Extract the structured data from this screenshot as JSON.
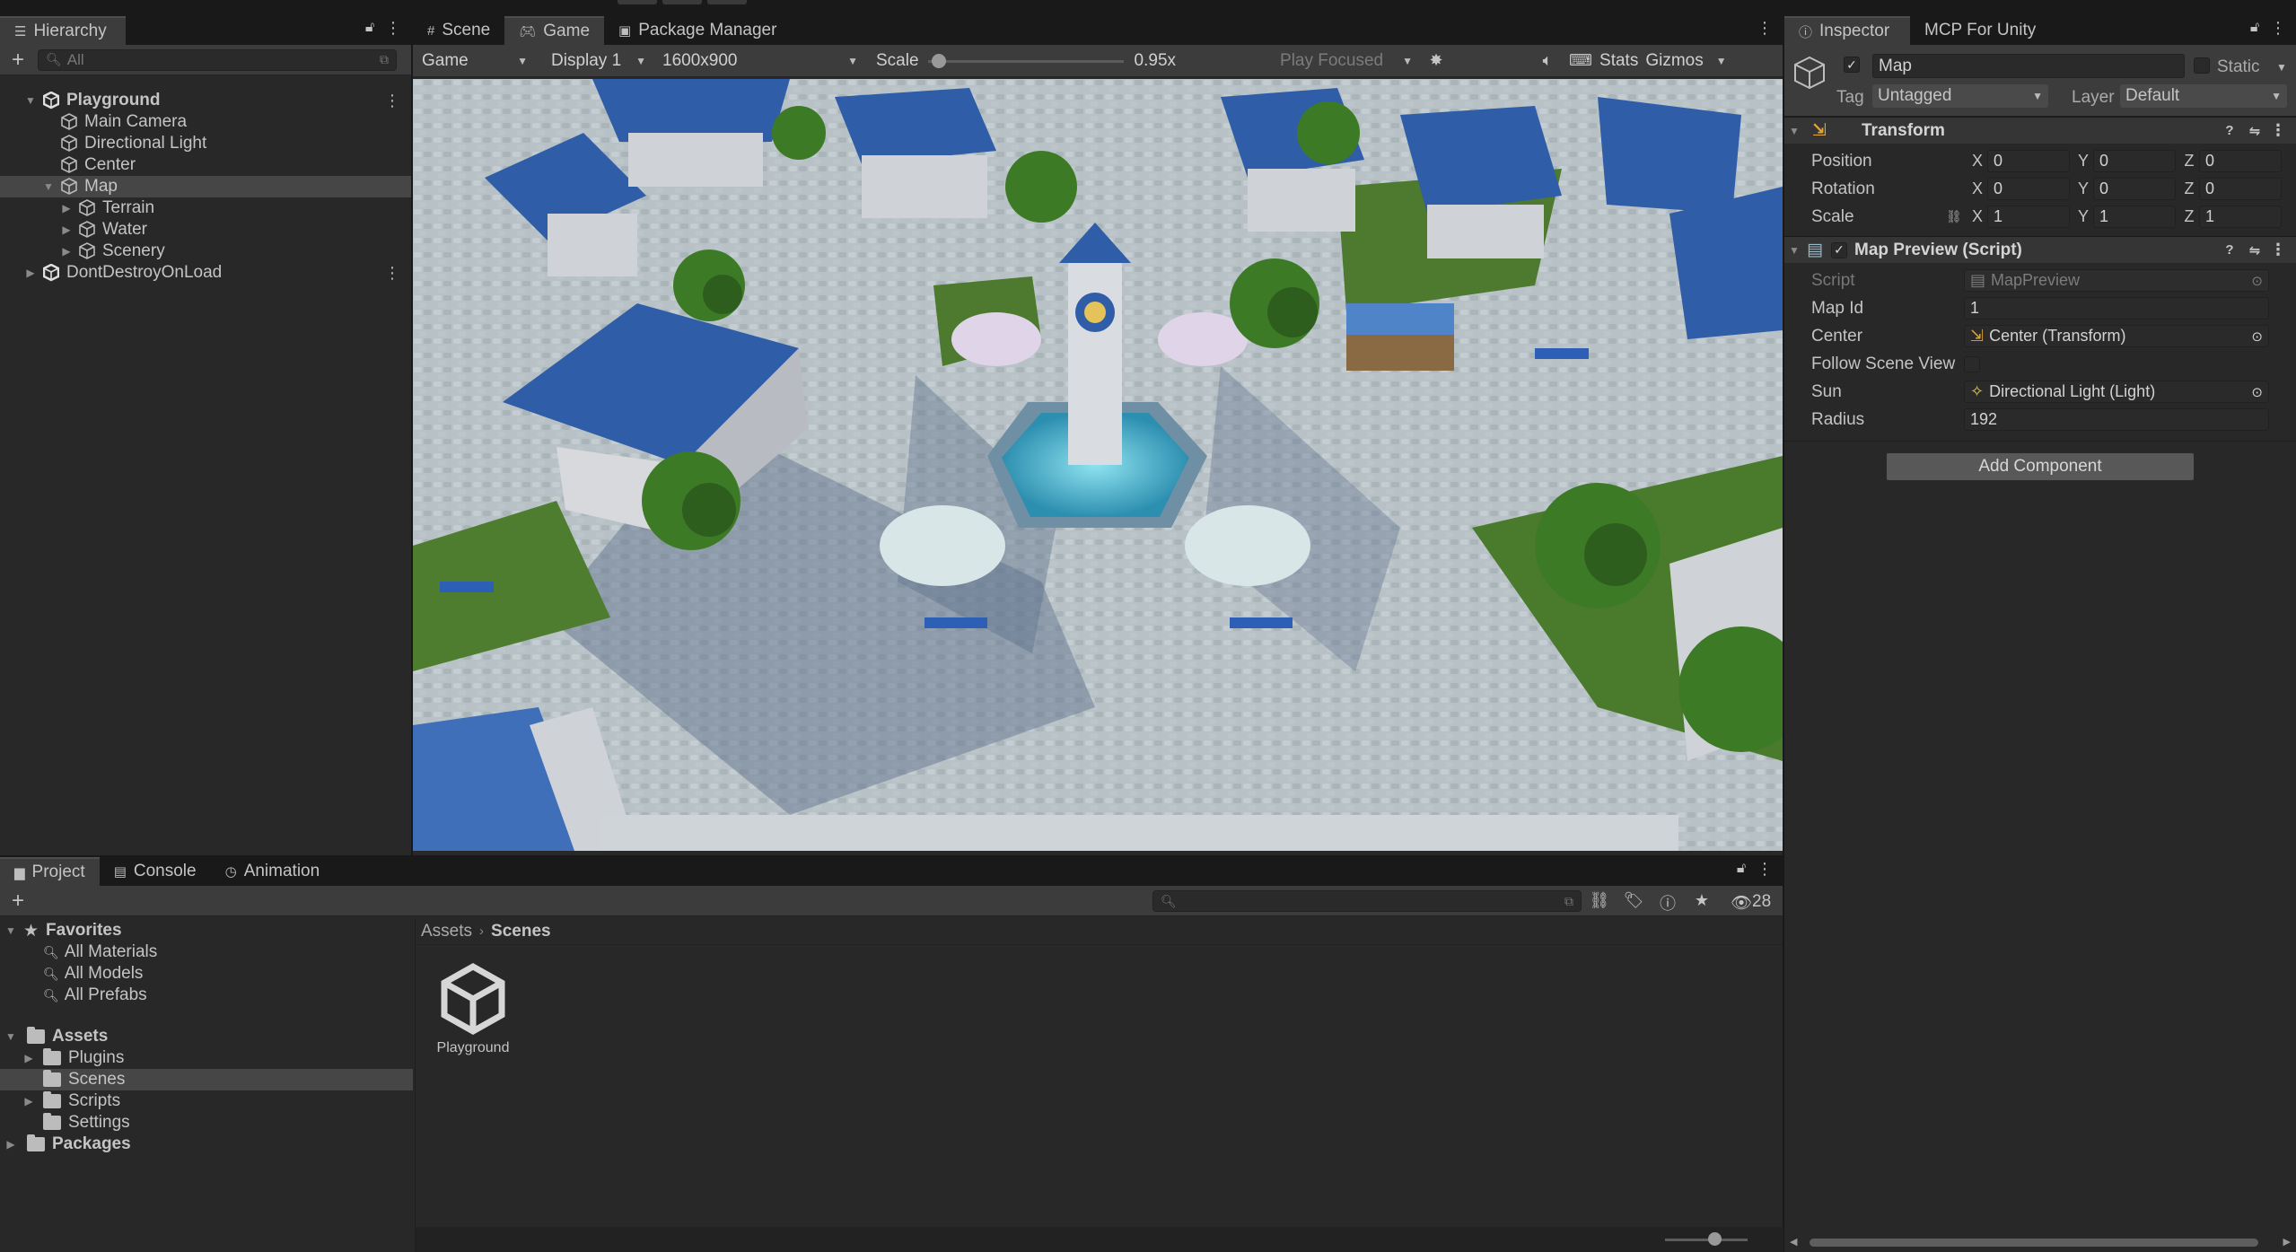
{
  "hierarchy": {
    "tab_label": "Hierarchy",
    "add_label": "+",
    "search_placeholder": "All",
    "items": [
      {
        "label": "Playground",
        "depth": 0,
        "expanded": true,
        "scene": true
      },
      {
        "label": "Main Camera",
        "depth": 1
      },
      {
        "label": "Directional Light",
        "depth": 1
      },
      {
        "label": "Center",
        "depth": 1
      },
      {
        "label": "Map",
        "depth": 1,
        "expanded": true,
        "selected": true
      },
      {
        "label": "Terrain",
        "depth": 2,
        "collapsed": true
      },
      {
        "label": "Water",
        "depth": 2,
        "collapsed": true
      },
      {
        "label": "Scenery",
        "depth": 2,
        "collapsed": true
      },
      {
        "label": "DontDestroyOnLoad",
        "depth": 0,
        "collapsed": true,
        "scene": true
      }
    ]
  },
  "center_tabs": [
    {
      "label": "Scene",
      "icon": "grid-icon"
    },
    {
      "label": "Game",
      "icon": "gamepad-icon",
      "active": true
    },
    {
      "label": "Package Manager",
      "icon": "package-icon"
    }
  ],
  "game_toolbar": {
    "view_mode": "Game",
    "display": "Display 1",
    "resolution": "1600x900",
    "scale_label": "Scale",
    "scale_value": "0.95x",
    "scale_fraction": 0.02,
    "play_mode": "Play Focused",
    "stats": "Stats",
    "gizmos": "Gizmos"
  },
  "inspector": {
    "tabs": [
      {
        "label": "Inspector",
        "active": true
      },
      {
        "label": "MCP For Unity"
      }
    ],
    "object_name": "Map",
    "static_label": "Static",
    "tag_label": "Tag",
    "tag_value": "Untagged",
    "layer_label": "Layer",
    "layer_value": "Default",
    "transform": {
      "title": "Transform",
      "position_label": "Position",
      "rotation_label": "Rotation",
      "scale_label": "Scale",
      "position": {
        "x": "0",
        "y": "0",
        "z": "0"
      },
      "rotation": {
        "x": "0",
        "y": "0",
        "z": "0"
      },
      "scale": {
        "x": "1",
        "y": "1",
        "z": "1"
      },
      "axis_x": "X",
      "axis_y": "Y",
      "axis_z": "Z"
    },
    "map_preview": {
      "title": "Map Preview (Script)",
      "script_label": "Script",
      "script_value": "MapPreview",
      "map_id_label": "Map Id",
      "map_id_value": "1",
      "center_label": "Center",
      "center_value": "Center (Transform)",
      "follow_label": "Follow Scene View",
      "sun_label": "Sun",
      "sun_value": "Directional Light (Light)",
      "radius_label": "Radius",
      "radius_value": "192"
    },
    "add_component": "Add Component"
  },
  "project": {
    "tabs": [
      {
        "label": "Project",
        "icon": "folder-icon",
        "active": true
      },
      {
        "label": "Console",
        "icon": "console-icon"
      },
      {
        "label": "Animation",
        "icon": "animation-icon"
      }
    ],
    "favorites_label": "Favorites",
    "favorites": [
      "All Materials",
      "All Models",
      "All Prefabs"
    ],
    "assets_label": "Assets",
    "assets": [
      {
        "label": "Plugins",
        "collapsed": true
      },
      {
        "label": "Scenes",
        "selected": true
      },
      {
        "label": "Scripts",
        "collapsed": true
      },
      {
        "label": "Settings"
      }
    ],
    "packages_label": "Packages",
    "breadcrumb": [
      "Assets",
      "Scenes"
    ],
    "visible_count": "28",
    "files": [
      {
        "label": "Playground"
      }
    ]
  },
  "colors": {
    "sky": "#6f8fa8",
    "roof_blue": "#2f5da8",
    "plaza": "#b9c3c7",
    "grass": "#4d7a2e",
    "water": "#3fa6c2"
  }
}
